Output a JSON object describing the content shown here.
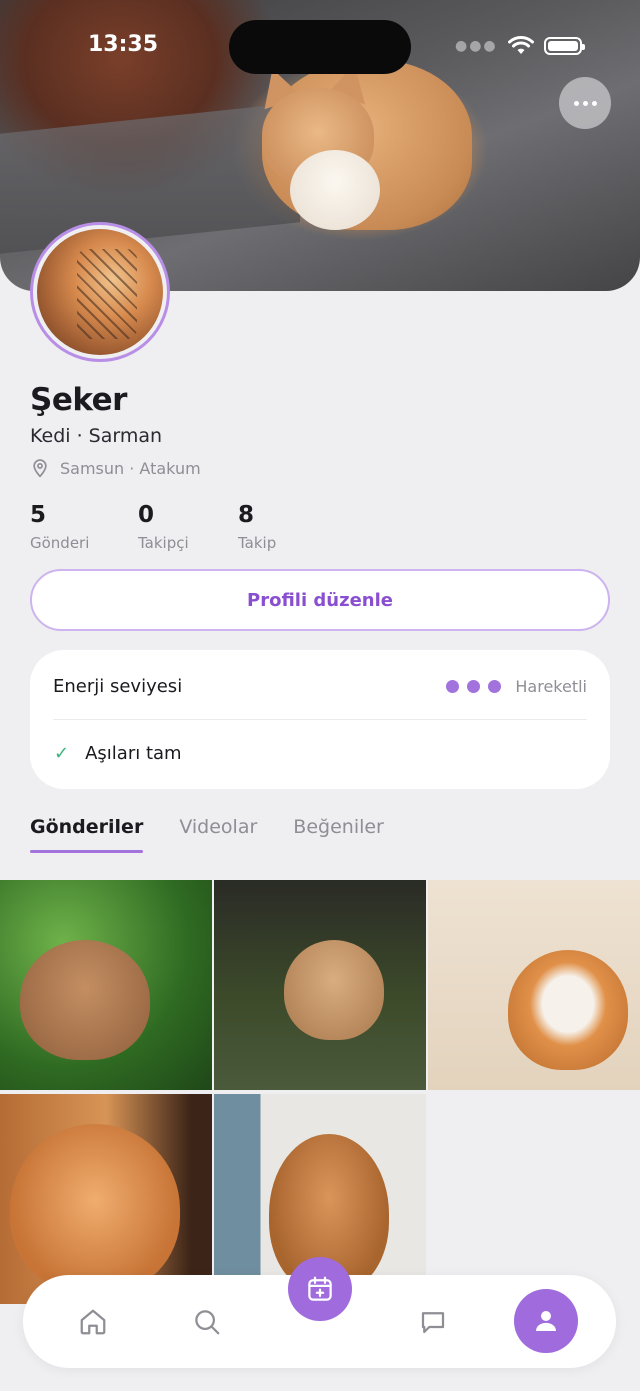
{
  "status_bar": {
    "time": "13:35"
  },
  "profile": {
    "name": "Şeker",
    "species": "Kedi · Sarman",
    "location": "Samsun · Atakum",
    "stats": [
      {
        "value": "5",
        "label": "Gönderi"
      },
      {
        "value": "0",
        "label": "Takipçi"
      },
      {
        "value": "8",
        "label": "Takip"
      }
    ],
    "edit_label": "Profili düzenle"
  },
  "info_card": {
    "energy_label": "Enerji seviyesi",
    "energy_value": "Hareketli",
    "energy_level": 3,
    "vaccination_label": "Aşıları tam"
  },
  "tabs": [
    {
      "label": "Gönderiler",
      "active": true
    },
    {
      "label": "Videolar",
      "active": false
    },
    {
      "label": "Beğeniler",
      "active": false
    }
  ],
  "gallery": {
    "count": 5
  },
  "nav": {
    "items": [
      "home-icon",
      "search-icon",
      "calendar-add-icon",
      "chat-icon",
      "user-icon"
    ],
    "active": "user-icon"
  },
  "colors": {
    "accent": "#a06bdc",
    "accent_text": "#8a4fd1",
    "check": "#3bb57a",
    "background": "#efeef1"
  }
}
